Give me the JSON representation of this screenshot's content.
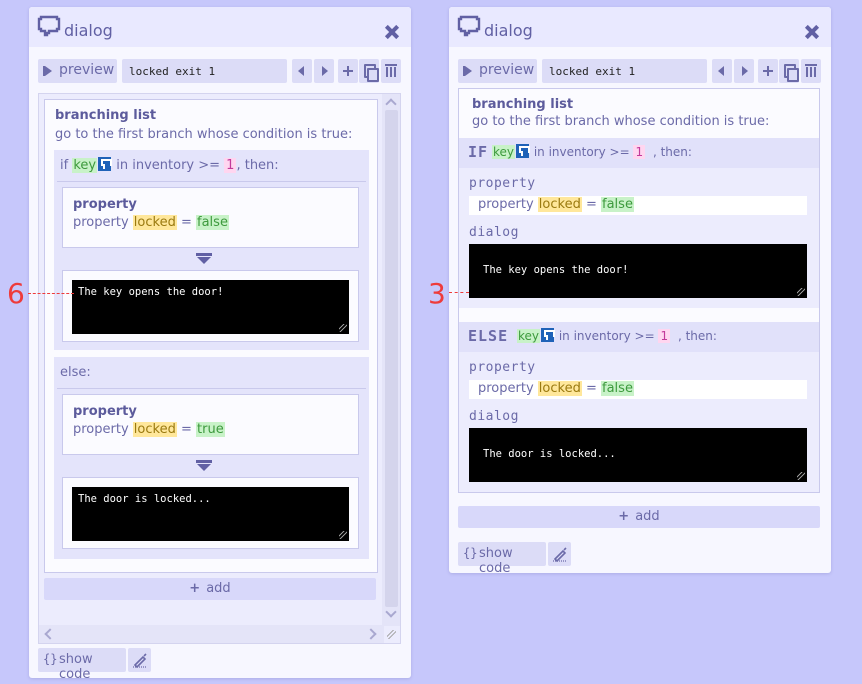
{
  "left": {
    "title": "dialog",
    "preview_label": "preview",
    "name_value": "locked exit 1",
    "branching_title": "branching list",
    "branching_desc": "go to the first branch whose condition is true:",
    "if_prefix": "if",
    "if_item": "key",
    "if_middle": "in inventory >=",
    "if_value": "1",
    "if_suffix": ", then:",
    "prop1_title": "property",
    "prop1_word": "property",
    "prop1_name": "locked",
    "prop1_eq": "=",
    "prop1_value": "false",
    "dialog1_text": "The key opens the door!",
    "else_label": "else:",
    "prop2_title": "property",
    "prop2_word": "property",
    "prop2_name": "locked",
    "prop2_eq": "=",
    "prop2_value": "true",
    "dialog2_text": "The door is locked...",
    "add_label": "add",
    "show_code_label": "show code",
    "annotation": "6"
  },
  "right": {
    "title": "dialog",
    "preview_label": "preview",
    "name_value": "locked exit 1",
    "branching_title": "branching list",
    "branching_desc": "go to the first branch whose condition is true:",
    "if_label": "IF",
    "if_item": "key",
    "if_middle": "in inventory >=",
    "if_value": "1",
    "if_suffix": ", then:",
    "sec_property": "property",
    "prop1_word": "property",
    "prop1_name": "locked",
    "prop1_eq": "=",
    "prop1_value": "false",
    "sec_dialog": "dialog",
    "dialog1_text": "The key opens the door!",
    "else_label": "ELSE",
    "else_item": "key",
    "else_middle": "in inventory >=",
    "else_value": "1",
    "else_suffix": ", then:",
    "sec_property2": "property",
    "prop2_word": "property",
    "prop2_name": "locked",
    "prop2_eq": "=",
    "prop2_value": "false",
    "sec_dialog2": "dialog",
    "dialog2_text": "The door is locked...",
    "add_label": "add",
    "show_code_label": "show code",
    "annotation": "3"
  },
  "colors": {
    "background": "#c6c7fb",
    "panel": "#f7f7ff",
    "accent": "#6160a4",
    "annotation": "#ee3b3b"
  }
}
